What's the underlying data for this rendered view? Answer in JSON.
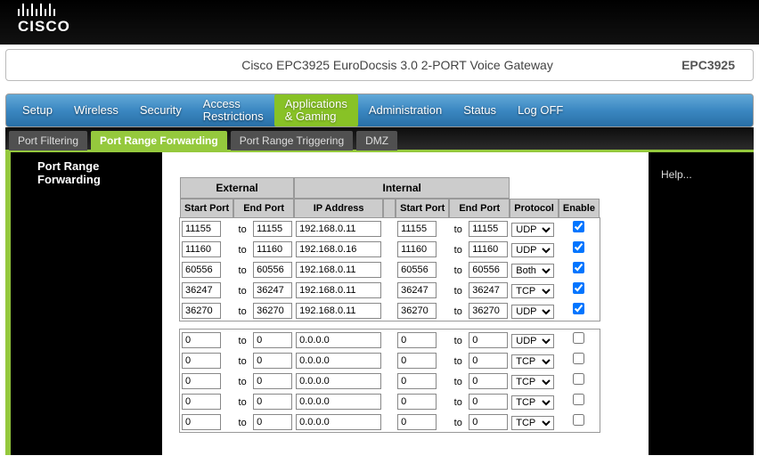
{
  "logo": "CISCO",
  "title": "Cisco EPC3925 EuroDocsis 3.0 2-PORT Voice Gateway",
  "model": "EPC3925",
  "nav": [
    "Setup",
    "Wireless",
    "Security",
    "Access\nRestrictions",
    "Applications\n& Gaming",
    "Administration",
    "Status",
    "Log OFF"
  ],
  "subnav": [
    "Port Filtering",
    "Port Range Forwarding",
    "Port Range Triggering",
    "DMZ"
  ],
  "page_heading": "Port Range Forwarding",
  "help": "Help...",
  "columns": {
    "external": "External",
    "internal": "Internal",
    "start": "Start Port",
    "end": "End Port",
    "ip": "IP Address",
    "proto": "Protocol",
    "enable": "Enable"
  },
  "to": "to",
  "proto_options": [
    "UDP",
    "TCP",
    "Both"
  ],
  "rows1": [
    {
      "es": "11155",
      "ee": "11155",
      "ip": "192.168.0.11",
      "is": "11155",
      "ie": "11155",
      "p": "UDP",
      "en": true
    },
    {
      "es": "11160",
      "ee": "11160",
      "ip": "192.168.0.16",
      "is": "11160",
      "ie": "11160",
      "p": "UDP",
      "en": true
    },
    {
      "es": "60556",
      "ee": "60556",
      "ip": "192.168.0.11",
      "is": "60556",
      "ie": "60556",
      "p": "Both",
      "en": true
    },
    {
      "es": "36247",
      "ee": "36247",
      "ip": "192.168.0.11",
      "is": "36247",
      "ie": "36247",
      "p": "TCP",
      "en": true
    },
    {
      "es": "36270",
      "ee": "36270",
      "ip": "192.168.0.11",
      "is": "36270",
      "ie": "36270",
      "p": "UDP",
      "en": true
    }
  ],
  "rows2": [
    {
      "es": "0",
      "ee": "0",
      "ip": "0.0.0.0",
      "is": "0",
      "ie": "0",
      "p": "UDP",
      "en": false
    },
    {
      "es": "0",
      "ee": "0",
      "ip": "0.0.0.0",
      "is": "0",
      "ie": "0",
      "p": "TCP",
      "en": false
    },
    {
      "es": "0",
      "ee": "0",
      "ip": "0.0.0.0",
      "is": "0",
      "ie": "0",
      "p": "TCP",
      "en": false
    },
    {
      "es": "0",
      "ee": "0",
      "ip": "0.0.0.0",
      "is": "0",
      "ie": "0",
      "p": "TCP",
      "en": false
    },
    {
      "es": "0",
      "ee": "0",
      "ip": "0.0.0.0",
      "is": "0",
      "ie": "0",
      "p": "TCP",
      "en": false
    }
  ]
}
